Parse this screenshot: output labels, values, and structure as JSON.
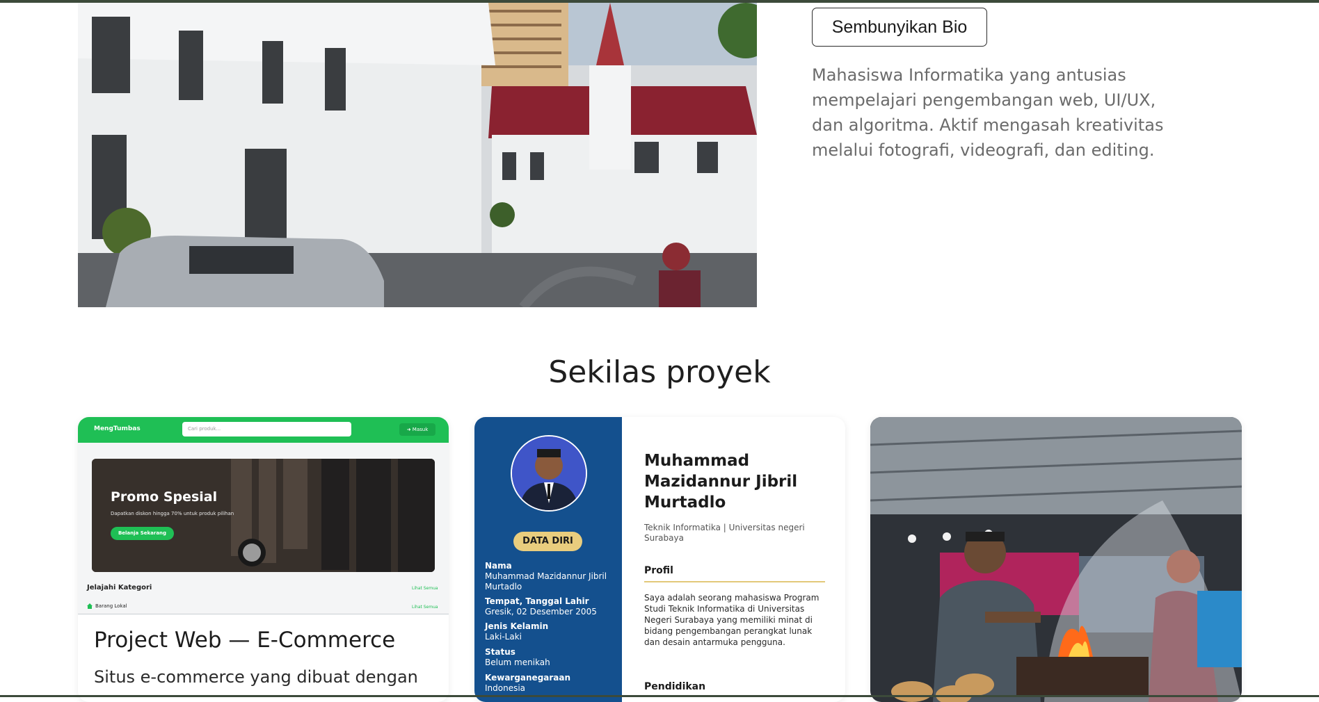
{
  "hero": {
    "bio_button": "Sembunyikan Bio",
    "bio_text": "Mahasiswa Informatika yang antusias mempelajari pengembangan web, UI/UX, dan algoritma. Aktif mengasah kreativitas melalui fotografi, videografi, dan editing."
  },
  "section": {
    "title": "Sekilas proyek"
  },
  "projects": [
    {
      "title": "Project Web — E-Commerce",
      "description": "Situs e-commerce yang dibuat dengan",
      "preview": {
        "brand": "MengTumbas",
        "search_placeholder": "Cari produk...",
        "login": "➜ Masuk",
        "banner_title": "Promo Spesial",
        "banner_sub": "Dapatkan diskon hingga 70% untuk produk pilihan",
        "banner_button": "Belanja Sekarang",
        "category_heading": "Jelajahi Kategori",
        "see_all_1": "Lihat Semua",
        "local_label": "Barang Lokal",
        "see_all_2": "Lihat Semua"
      }
    },
    {
      "cv": {
        "badge": "DATA DIRI",
        "fields": [
          {
            "label": "Nama",
            "value": "Muhammad Mazidannur Jibril Murtadlo"
          },
          {
            "label": "Tempat, Tanggal Lahir",
            "value": "Gresik, 02 Desember 2005"
          },
          {
            "label": "Jenis Kelamin",
            "value": "Laki-Laki"
          },
          {
            "label": "Status",
            "value": "Belum menikah"
          },
          {
            "label": "Kewarganegaraan",
            "value": "Indonesia"
          }
        ],
        "name": "Muhammad Mazidannur Jibril Murtadlo",
        "subtitle": "Teknik Informatika | Universitas negeri Surabaya",
        "profile_heading": "Profil",
        "profile_text": "Saya adalah seorang mahasiswa Program Studi Teknik Informatika di Universitas Negeri Surabaya yang memiliki minat di bidang pengembangan perangkat lunak dan desain antarmuka pengguna.",
        "education_heading": "Pendidikan"
      }
    },
    {
      "photo_icon": "street-food-photo"
    }
  ]
}
